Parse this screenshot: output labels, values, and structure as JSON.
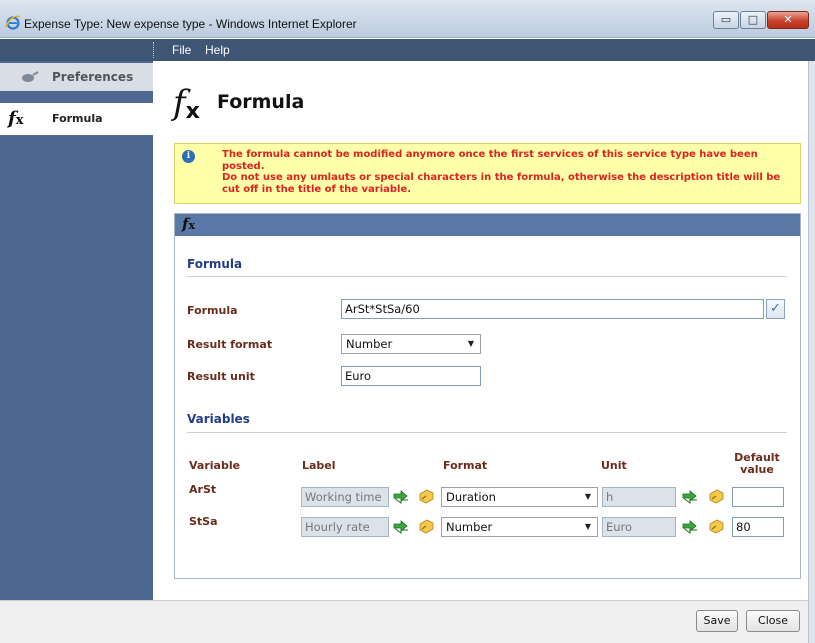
{
  "window": {
    "title": "Expense Type: New expense type - Windows Internet Explorer",
    "controls": {
      "minimize": "▭",
      "maximize": "□",
      "close": "✕"
    }
  },
  "menu": {
    "items": [
      "File",
      "Help"
    ]
  },
  "sidebar": {
    "items": [
      {
        "label": "Preferences",
        "icon": "gear-icon"
      },
      {
        "label": "Formula",
        "icon": "fx-icon"
      }
    ]
  },
  "page": {
    "fx_symbol": "f",
    "fx_sub": "x",
    "title": "Formula"
  },
  "notice": {
    "lines": [
      "The formula cannot be modified anymore once the first services of this service type have been posted.",
      "Do not use any umlauts or special characters in the formula, otherwise the description title will be cut off in the title of the variable."
    ]
  },
  "panel": {
    "header_icon": "fx",
    "formula_section": {
      "title": "Formula",
      "formula_label": "Formula",
      "formula_value": "ArSt*StSa/60",
      "result_format_label": "Result format",
      "result_format_value": "Number",
      "result_unit_label": "Result unit",
      "result_unit_value": "Euro"
    },
    "variables_section": {
      "title": "Variables",
      "columns": {
        "variable": "Variable",
        "label": "Label",
        "format": "Format",
        "unit": "Unit",
        "default_line1": "Default",
        "default_line2": "value"
      },
      "rows": [
        {
          "variable": "ArSt",
          "label": "Working time",
          "format": "Duration",
          "unit": "h",
          "default": ""
        },
        {
          "variable": "StSa",
          "label": "Hourly rate",
          "format": "Number",
          "unit": "Euro",
          "default": "80"
        }
      ]
    }
  },
  "buttons": {
    "save": "Save",
    "close": "Close"
  },
  "colors": {
    "notice_bg": "#ffffaa",
    "notice_text": "#dd2222",
    "panel_head": "#5a78a6",
    "sidebar": "#4f6892",
    "section_title": "#233c86",
    "label": "#6b2b1d"
  }
}
